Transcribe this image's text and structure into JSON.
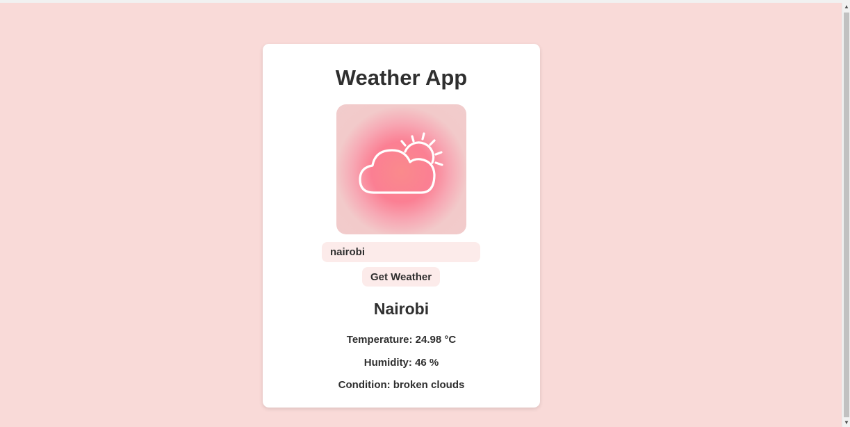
{
  "app": {
    "title": "Weather App",
    "weather_icon": "cloud-sun-icon"
  },
  "search": {
    "value": "nairobi",
    "button_label": "Get Weather"
  },
  "result": {
    "city": "Nairobi",
    "temperature": "Temperature: 24.98 °C",
    "humidity": "Humidity: 46 %",
    "condition": "Condition: broken clouds"
  },
  "colors": {
    "page_background": "#f9dad8",
    "card_background": "#ffffff",
    "input_background": "#fcebea",
    "icon_glow": "#fb7f93"
  }
}
